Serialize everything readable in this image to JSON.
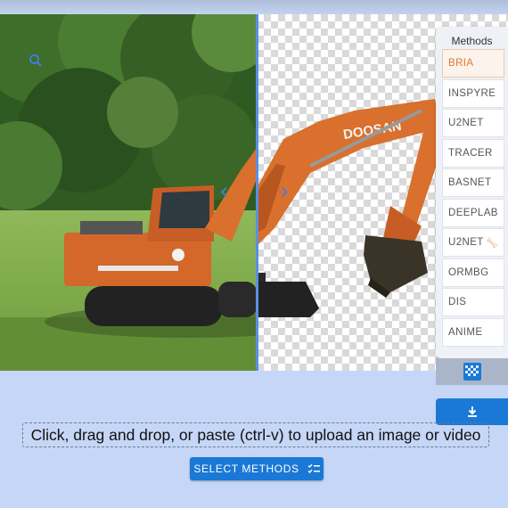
{
  "methods_panel": {
    "title": "Methods",
    "items": [
      {
        "label": "BRIA",
        "active": true
      },
      {
        "label": "INSPYRE"
      },
      {
        "label": "U2NET"
      },
      {
        "label": "TRACER"
      },
      {
        "label": "BASNET"
      },
      {
        "label": "DEEPLAB"
      },
      {
        "label": "U2NET",
        "badge": "🦴"
      },
      {
        "label": "ORMBG"
      },
      {
        "label": "DIS"
      },
      {
        "label": "ANIME"
      }
    ]
  },
  "excavator_brand": "DOOSAN",
  "upload": {
    "prompt": "Click, drag and drop, or paste (ctrl-v) to upload an image or video"
  },
  "select_methods": {
    "label": "SELECT METHODS"
  },
  "colors": {
    "accent": "#1a78d6",
    "active_method": "#e07a2e",
    "page_background": "#c6d6f7",
    "divider": "#5b8fe0"
  },
  "icons": {
    "zoom": "search-icon",
    "prev": "chevron-left-icon",
    "next": "chevron-right-icon",
    "compare": "checkerboard-icon",
    "download": "download-icon",
    "select": "checklist-icon"
  }
}
